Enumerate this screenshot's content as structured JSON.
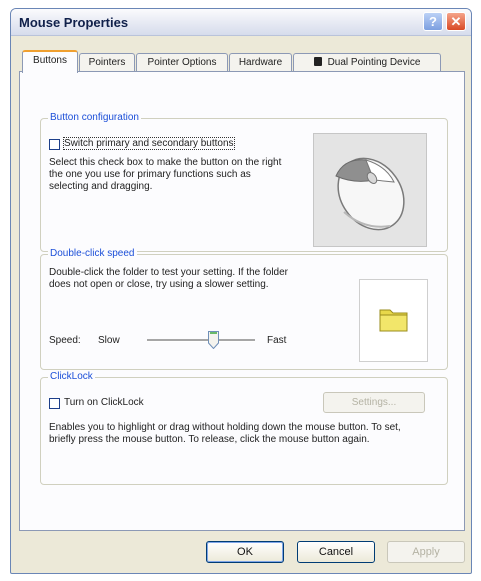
{
  "window": {
    "title": "Mouse Properties",
    "help_glyph": "?",
    "close_glyph": "✕"
  },
  "tabs": [
    {
      "label": "Buttons",
      "active": true
    },
    {
      "label": "Pointers",
      "active": false
    },
    {
      "label": "Pointer Options",
      "active": false
    },
    {
      "label": "Hardware",
      "active": false
    },
    {
      "label": "Dual Pointing Device",
      "active": false
    }
  ],
  "button_configuration": {
    "legend": "Button configuration",
    "checkbox_label": "Switch primary and secondary buttons",
    "checked": false,
    "description": "Select this check box to make the button on the right the one you use for primary functions such as selecting and dragging."
  },
  "double_click_speed": {
    "legend": "Double-click speed",
    "description": "Double-click the folder to test your setting. If the folder does not open or close, try using a slower setting.",
    "speed_label": "Speed:",
    "slow_label": "Slow",
    "fast_label": "Fast",
    "level": 0.62
  },
  "clicklock": {
    "legend": "ClickLock",
    "checkbox_label": "Turn on ClickLock",
    "checked": false,
    "settings_label": "Settings...",
    "description": "Enables you to highlight or drag without holding down the mouse button. To set, briefly press the mouse button. To release, click the mouse button again."
  },
  "footer": {
    "ok": "OK",
    "cancel": "Cancel",
    "apply": "Apply"
  },
  "colors": {
    "accent": "#1c4fd8",
    "tab_highlight": "#f0a030",
    "close_button": "#d94a26"
  }
}
